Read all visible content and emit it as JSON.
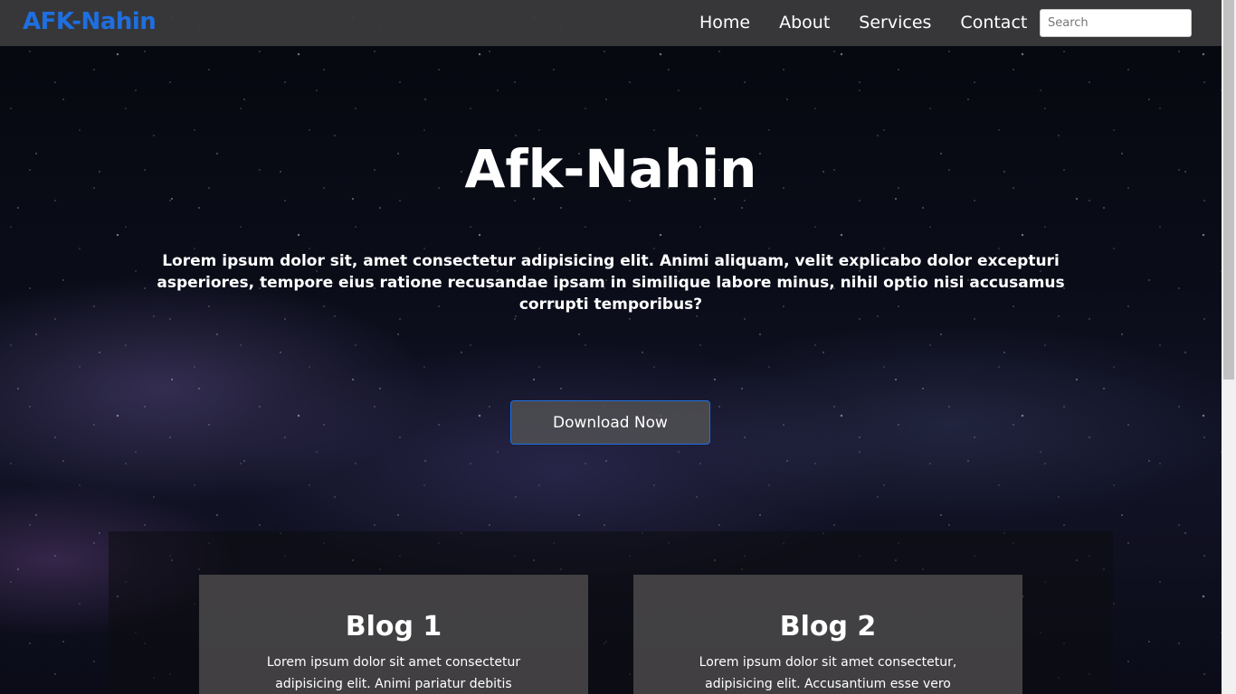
{
  "navbar": {
    "brand": "AFK-Nahin",
    "links": [
      "Home",
      "About",
      "Services",
      "Contact"
    ],
    "search_placeholder": "Search"
  },
  "hero": {
    "title": "Afk-Nahin",
    "text": "Lorem ipsum dolor sit, amet consectetur adipisicing elit. Animi aliquam, velit explicabo dolor excepturi asperiores, tempore eius ratione recusandae ipsam in similique labore minus, nihil optio nisi accusamus corrupti temporibus?",
    "button_label": "Download Now"
  },
  "blogs": [
    {
      "title": "Blog 1",
      "text": "Lorem ipsum dolor sit amet consectetur adipisicing elit. Animi pariatur debitis"
    },
    {
      "title": "Blog 2",
      "text": "Lorem ipsum dolor sit amet consectetur, adipisicing elit. Accusantium esse vero architecto,"
    }
  ],
  "colors": {
    "brand": "#1e6fe0",
    "navbar_bg": "#3c3c3e",
    "card_bg": "#464446"
  }
}
